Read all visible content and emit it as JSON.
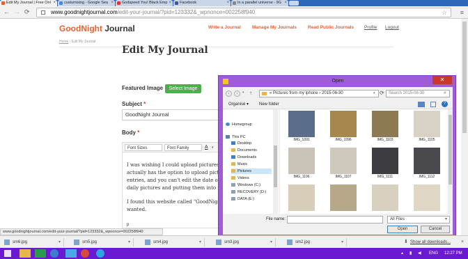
{
  "browser": {
    "tabs": [
      {
        "label": "Edit My Journal | Free Onl",
        "active": true,
        "color": "#e8602e"
      },
      {
        "label": "custumising - Google Sea",
        "active": false,
        "color": "#4285f4"
      },
      {
        "label": "Godspeed You! Black Emp",
        "active": false,
        "color": "#d33"
      },
      {
        "label": "Facebook",
        "active": false,
        "color": "#3b5998"
      },
      {
        "label": "In a parallel universe - 9G",
        "active": false,
        "color": "#888"
      }
    ],
    "url_host": "www.goodnightjournal.com",
    "url_path": "/edit-your-journal/?pid=123332&_wpnonce=002258f940",
    "status_url": "www.goodnightjournal.com/edit-your-journal/?pid=123332&_wpnonce=002258f940"
  },
  "site": {
    "logo_a": "GoodNight",
    "logo_b": " Journal",
    "nav": [
      "Write a Journal",
      "Manage My Journals",
      "Read Public Journals",
      "Profile",
      "Logout"
    ],
    "breadcrumb_home": "Home",
    "breadcrumb_current": " › Edit My Journal",
    "page_title": "Edit My Journal",
    "featured_label": "Featured Image",
    "select_image": "Select Image",
    "subject_label": "Subject",
    "required_mark": "*",
    "subject_value": "GoodNight Journal",
    "body_label": "Body",
    "font_sizes": "Font Sizes",
    "font_family": "Font Family",
    "body_lines": [
      "I was wishing I could upload pictures to",
      "actually has the option to upload pictur",
      "entries, and you can't edit the date of th",
      "daily pictures and putting them into m",
      "",
      "I found this website called \"GoodNight",
      "wanted."
    ],
    "path_tag": "p"
  },
  "dialog": {
    "title": "Open",
    "path": "«  Pictures from my iphone  ›  2015-06-30",
    "search_placeholder": "Search 2015-06-30",
    "organise": "Organise ▾",
    "new_folder": "New folder",
    "tree": [
      {
        "label": "Homegroup",
        "indent": 0
      },
      {
        "label": "This PC",
        "indent": 0
      },
      {
        "label": "Desktop",
        "indent": 1
      },
      {
        "label": "Documents",
        "indent": 1
      },
      {
        "label": "Downloads",
        "indent": 1
      },
      {
        "label": "Music",
        "indent": 1
      },
      {
        "label": "Pictures",
        "indent": 1,
        "selected": true
      },
      {
        "label": "Videos",
        "indent": 1
      },
      {
        "label": "Windows (C:)",
        "indent": 1
      },
      {
        "label": "RECOVERY (D:)",
        "indent": 1
      },
      {
        "label": "DATA (E:)",
        "indent": 1
      }
    ],
    "files": [
      {
        "name": "IMG_1091",
        "tone": "#5a6e8c"
      },
      {
        "name": "IMG_1096",
        "tone": "#a6884f"
      },
      {
        "name": "IMG_1103",
        "tone": "#8e7a52"
      },
      {
        "name": "IMG_1105",
        "tone": "#d8d2c6"
      },
      {
        "name": "IMG_1106",
        "tone": "#c9c3b7"
      },
      {
        "name": "IMG_1107",
        "tone": "#cfc9bd"
      },
      {
        "name": "IMG_1111",
        "tone": "#3c3c40"
      },
      {
        "name": "IMG_1112",
        "tone": "#4a4a4e"
      },
      {
        "name": "",
        "tone": "#d7cdb8"
      },
      {
        "name": "",
        "tone": "#b8a88a"
      },
      {
        "name": "",
        "tone": "#d9d1c0"
      },
      {
        "name": "",
        "tone": "#e0d6c4"
      }
    ],
    "file_name_label": "File name:",
    "file_type": "All Files",
    "open_btn": "Open",
    "cancel_btn": "Cancel"
  },
  "downloads": {
    "items": [
      "sm6.jpg",
      "sm5.jpg",
      "sm4.jpg",
      "sm3.jpg",
      "sm2.jpg"
    ],
    "show_all": "Show all downloads...",
    "close": "×"
  },
  "taskbar": {
    "lang": "ENG",
    "time": "12:27 PM",
    "color": "#6a1bd1"
  }
}
